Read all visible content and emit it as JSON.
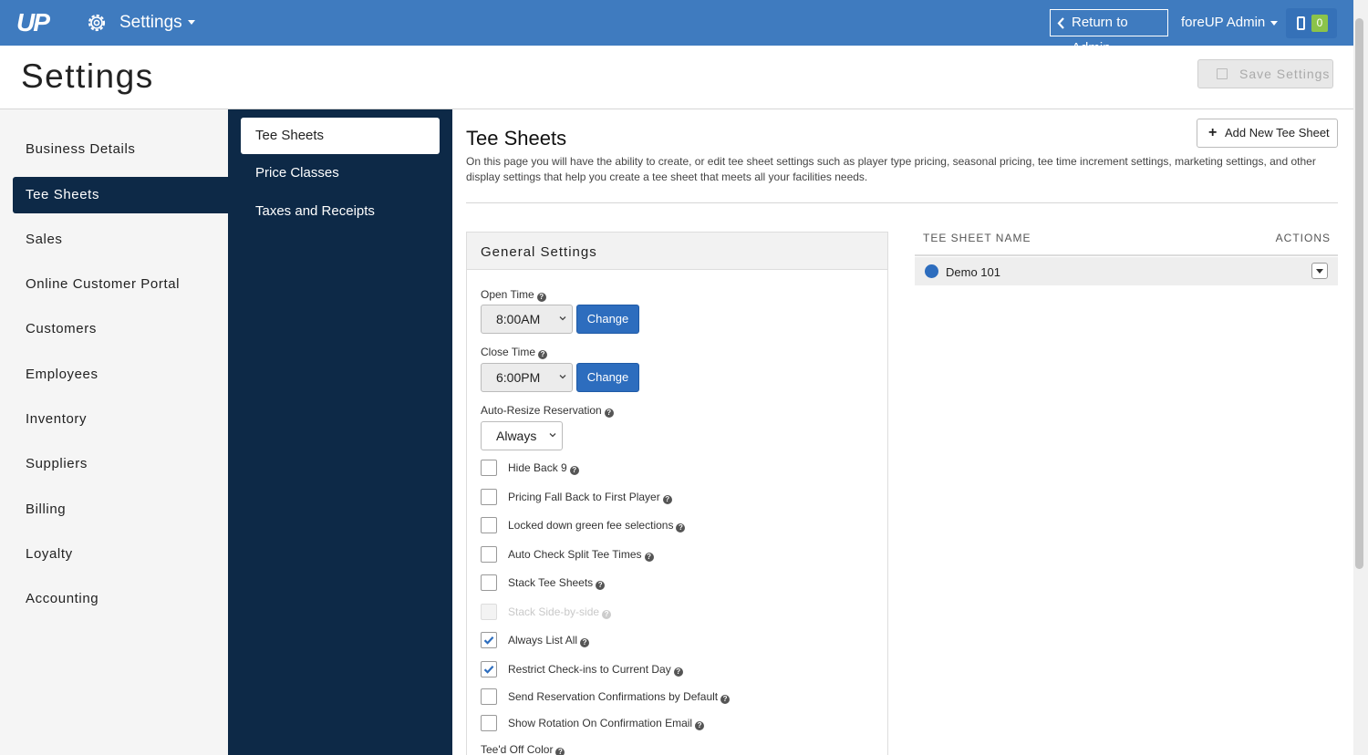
{
  "topbar": {
    "logo": "UP",
    "app_menu": "Settings",
    "return_label": "Return to Admin",
    "user_menu": "foreUP Admin",
    "badge_count": "0"
  },
  "page": {
    "title": "Settings",
    "save_label": "Save Settings"
  },
  "leftnav": {
    "items": [
      {
        "label": "Business Details"
      },
      {
        "label": "Tee Sheets"
      },
      {
        "label": "Sales"
      },
      {
        "label": "Online Customer Portal"
      },
      {
        "label": "Customers"
      },
      {
        "label": "Employees"
      },
      {
        "label": "Inventory"
      },
      {
        "label": "Suppliers"
      },
      {
        "label": "Billing"
      },
      {
        "label": "Loyalty"
      },
      {
        "label": "Accounting"
      }
    ]
  },
  "subnav": {
    "items": [
      {
        "label": "Tee Sheets"
      },
      {
        "label": "Price Classes"
      },
      {
        "label": "Taxes and Receipts"
      }
    ]
  },
  "main": {
    "title": "Tee Sheets",
    "description": "On this page you will have the ability to create, or edit tee sheet settings such as player type pricing, seasonal pricing, tee time increment settings, marketing settings, and other display settings that help you create a tee sheet that meets all your facilities needs.",
    "add_label": "Add New Tee Sheet"
  },
  "general": {
    "title": "General Settings",
    "open_time_label": "Open Time",
    "open_time_value": "8:00AM",
    "close_time_label": "Close Time",
    "close_time_value": "6:00PM",
    "change_label": "Change",
    "auto_resize_label": "Auto-Resize Reservation",
    "auto_resize_value": "Always",
    "checkboxes": [
      {
        "label": "Hide Back 9",
        "checked": false
      },
      {
        "label": "Pricing Fall Back to First Player",
        "checked": false
      },
      {
        "label": "Locked down green fee selections",
        "checked": false
      },
      {
        "label": "Auto Check Split Tee Times",
        "checked": false
      },
      {
        "label": "Stack Tee Sheets",
        "checked": false
      },
      {
        "label": "Stack Side-by-side",
        "checked": false,
        "disabled": true
      },
      {
        "label": "Always List All",
        "checked": true
      },
      {
        "label": "Restrict Check-ins to Current Day",
        "checked": true
      },
      {
        "label": "Send Reservation Confirmations by Default",
        "checked": false
      },
      {
        "label": "Show Rotation On Confirmation Email",
        "checked": false
      }
    ],
    "teed_off_label": "Tee'd Off Color"
  },
  "teesheet_list": {
    "col_name": "TEE SHEET NAME",
    "col_actions": "ACTIONS",
    "rows": [
      {
        "name": "Demo 101",
        "color": "#2d6dbe"
      }
    ]
  },
  "colors": {
    "topbar": "#3f7bbf",
    "nav_dark": "#0d2947",
    "primary_button": "#2d6dbe",
    "badge": "#8bc34a"
  }
}
